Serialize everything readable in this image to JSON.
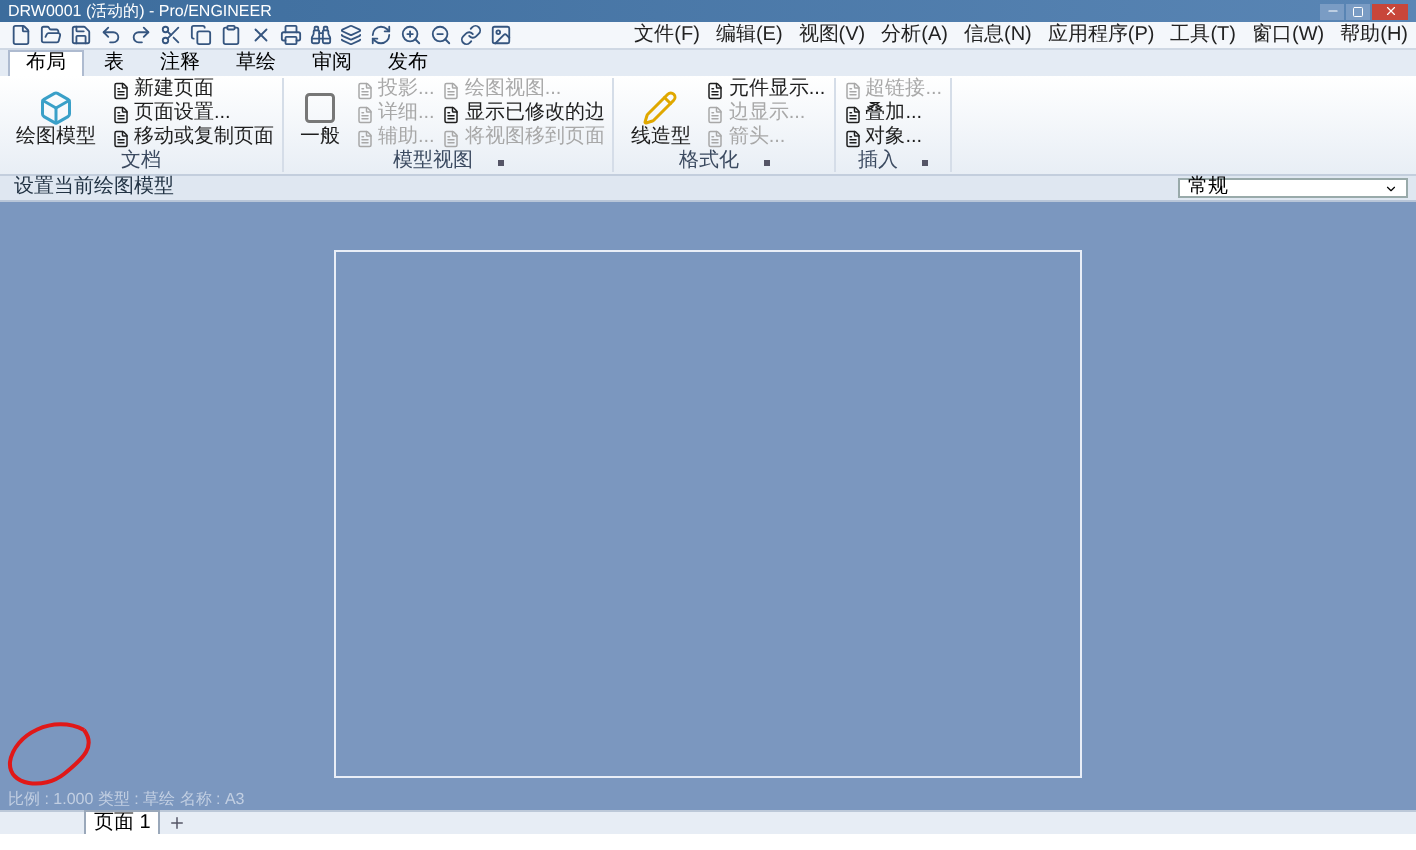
{
  "window": {
    "title": "DRW0001 (活动的) - Pro/ENGINEER"
  },
  "menu": [
    "文件(F)",
    "编辑(E)",
    "视图(V)",
    "分析(A)",
    "信息(N)",
    "应用程序(P)",
    "工具(T)",
    "窗口(W)",
    "帮助(H)"
  ],
  "tabs": [
    {
      "label": "布局",
      "selected": true
    },
    {
      "label": "表",
      "selected": false
    },
    {
      "label": "注释",
      "selected": false
    },
    {
      "label": "草绘",
      "selected": false
    },
    {
      "label": "审阅",
      "selected": false
    },
    {
      "label": "发布",
      "selected": false
    }
  ],
  "groups": [
    {
      "label": "文档",
      "launcher": false,
      "items": [
        {
          "label": "绘图模型",
          "kind": "large",
          "disabled": false
        },
        {
          "label": "新建页面",
          "kind": "small",
          "disabled": false
        },
        {
          "label": "页面设置...",
          "kind": "small",
          "disabled": false
        },
        {
          "label": "移动或复制页面",
          "kind": "small",
          "disabled": false
        }
      ]
    },
    {
      "label": "模型视图",
      "launcher": true,
      "items": [
        {
          "label": "一般",
          "kind": "large",
          "disabled": false
        },
        {
          "label": "投影...",
          "kind": "small",
          "disabled": true
        },
        {
          "label": "详细...",
          "kind": "small",
          "disabled": true
        },
        {
          "label": "辅助...",
          "kind": "small",
          "disabled": true
        },
        {
          "label": "绘图视图...",
          "kind": "small",
          "disabled": true
        },
        {
          "label": "显示已修改的边",
          "kind": "small",
          "disabled": false
        },
        {
          "label": "将视图移到页面",
          "kind": "small",
          "disabled": true
        }
      ]
    },
    {
      "label": "格式化",
      "launcher": true,
      "items": [
        {
          "label": "线造型",
          "kind": "large",
          "disabled": false
        },
        {
          "label": "元件显示...",
          "kind": "small",
          "disabled": false
        },
        {
          "label": "边显示...",
          "kind": "small",
          "disabled": true
        },
        {
          "label": "箭头...",
          "kind": "small",
          "disabled": true
        }
      ]
    },
    {
      "label": "插入",
      "launcher": true,
      "items": [
        {
          "label": "超链接...",
          "kind": "small",
          "disabled": true
        },
        {
          "label": "叠加...",
          "kind": "small",
          "disabled": false
        },
        {
          "label": "对象...",
          "kind": "small",
          "disabled": false
        }
      ]
    }
  ],
  "message": "设置当前绘图模型",
  "style_filter": {
    "value": "常规"
  },
  "status_text": "比例 : 1.000   类型 : 草绘   名称 : A3",
  "page_tabs": [
    {
      "label": "页面 1",
      "selected": true
    }
  ]
}
